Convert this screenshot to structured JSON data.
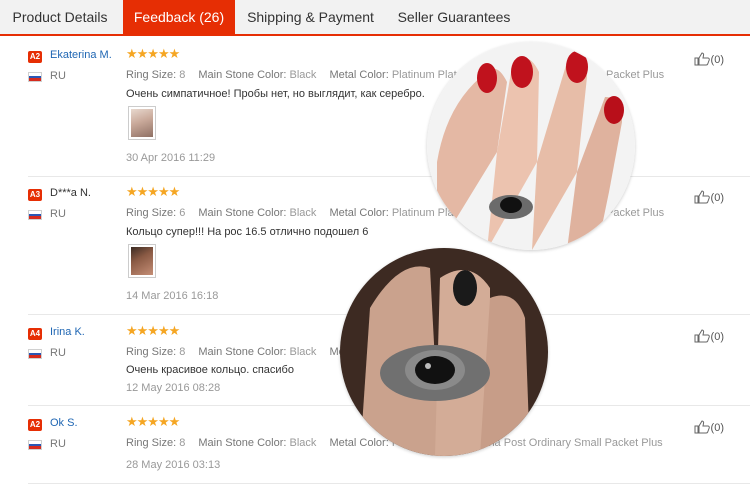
{
  "tabs": [
    {
      "label": "Product Details"
    },
    {
      "label": "Feedback (26)"
    },
    {
      "label": "Shipping & Payment"
    },
    {
      "label": "Seller Guarantees"
    }
  ],
  "labels": {
    "ring_size": "Ring Size:",
    "main_stone_color": "Main Stone Color:",
    "metal_color": "Metal Color:"
  },
  "colors": {
    "accent": "#e62e04",
    "link": "#1f66b3",
    "star": "#f5a623"
  },
  "reviews": [
    {
      "badge": "A2",
      "name": "Ekaterina M.",
      "country": "RU",
      "stars": "★★★★★",
      "ring_size": "8",
      "main_stone_color": "Black",
      "metal_color": "Platinum Plated",
      "shipping_tail": "Packet Plus",
      "text": "Очень симпатичное! Пробы нет, но выглядит, как серебро.",
      "date": "30 Apr 2016 11:29",
      "helpful": "(0)"
    },
    {
      "badge": "A3",
      "name": "D***a N.",
      "country": "RU",
      "stars": "★★★★★",
      "ring_size": "6",
      "main_stone_color": "Black",
      "metal_color": "Platinum Plated",
      "shipping_tail": "Packet Plus",
      "text": "Кольцо супер!!! На рос 16.5 отлично подошел 6",
      "date": "14 Mar 2016 16:18",
      "helpful": "(0)"
    },
    {
      "badge": "A4",
      "name": "Irina K.",
      "country": "RU",
      "stars": "★★★★★",
      "ring_size": "8",
      "main_stone_color": "Black",
      "metal_color": "Meta",
      "text": "Очень красивое кольцо. спасибо",
      "date": "12 May 2016 08:28",
      "helpful": "(0)"
    },
    {
      "badge": "A2",
      "name": "Ok S.",
      "country": "RU",
      "stars": "★★★★★",
      "ring_size": "8",
      "main_stone_color": "Black",
      "metal_color": "Platinum Plated",
      "shipping_tail": "ina Post Ordinary Small Packet Plus",
      "date": "28 May 2016 03:13",
      "helpful": "(0)"
    }
  ]
}
